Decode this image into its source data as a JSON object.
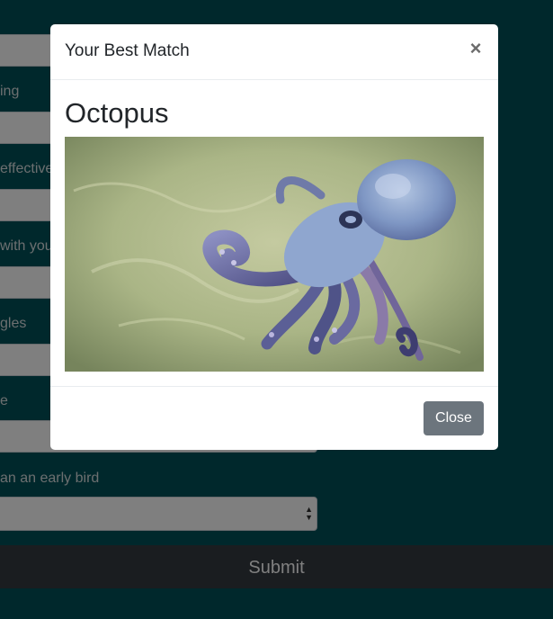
{
  "form": {
    "labels": [
      "ing",
      "effective",
      "with you",
      "gles",
      "e",
      "an an early bird"
    ],
    "submit_label": "Submit"
  },
  "modal": {
    "title": "Your Best Match",
    "close_symbol": "×",
    "animal_name": "Octopus",
    "image_subject": "octopus on sandy sea floor",
    "close_button_label": "Close"
  },
  "colors": {
    "page_background": "#005158",
    "submit_background": "#343a40",
    "close_button": "#6c757d"
  }
}
